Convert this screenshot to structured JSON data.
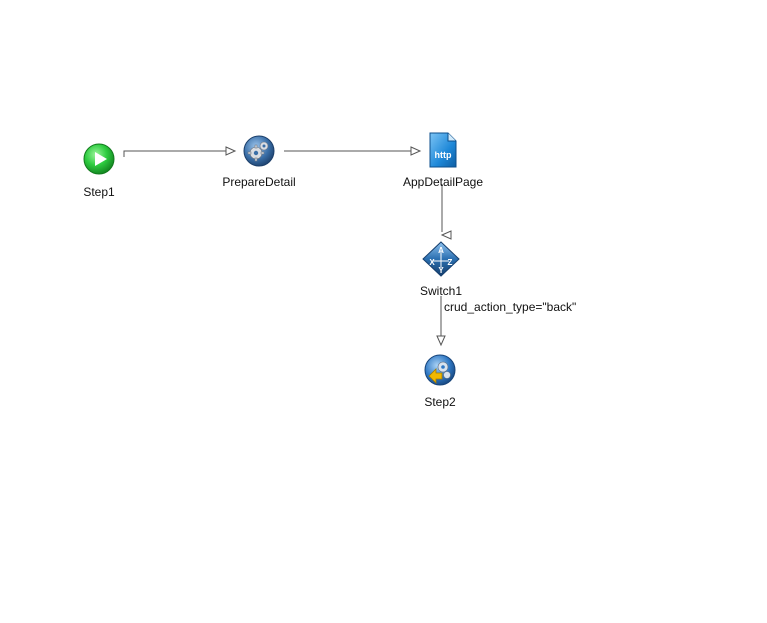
{
  "nodes": {
    "step1": {
      "label": "Step1",
      "type": "start",
      "icon": "play-icon"
    },
    "prepare_detail": {
      "label": "PrepareDetail",
      "type": "action",
      "icon": "gear-icon"
    },
    "app_detail_page": {
      "label": "AppDetailPage",
      "type": "page",
      "icon": "http-page-icon",
      "icon_text": "http"
    },
    "switch1": {
      "label": "Switch1",
      "type": "switch",
      "icon": "switch-icon",
      "icon_text": [
        "A",
        "X",
        "Z",
        "Y"
      ]
    },
    "step2": {
      "label": "Step2",
      "type": "end",
      "icon": "gear-back-icon"
    }
  },
  "edges": [
    {
      "from": "Step1",
      "to": "PrepareDetail",
      "label": ""
    },
    {
      "from": "PrepareDetail",
      "to": "AppDetailPage",
      "label": ""
    },
    {
      "from": "AppDetailPage",
      "to": "Switch1",
      "label": ""
    },
    {
      "from": "Switch1",
      "to": "Step2",
      "label": "crud_action_type=\"back\""
    }
  ],
  "colors": {
    "edge": "#555555",
    "start_green": "#2ecc40",
    "gear_blue": "#3a6fa8",
    "page_blue": "#1e88d8",
    "switch_blue": "#2a6fb0",
    "back_arrow": "#f0b800"
  }
}
